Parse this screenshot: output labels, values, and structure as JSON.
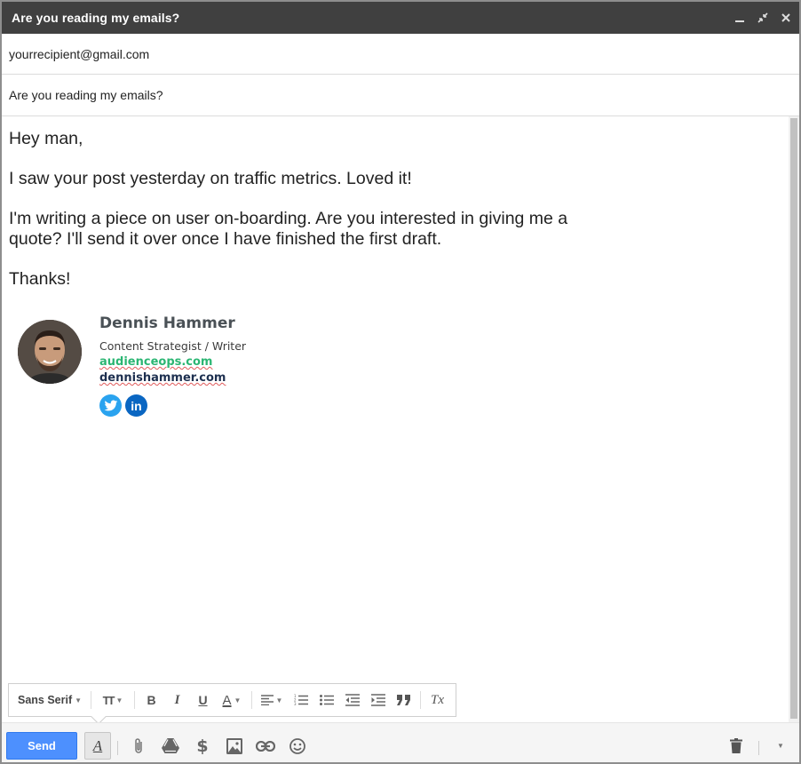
{
  "window": {
    "title": "Are you reading my emails?",
    "controls": [
      "minimize-icon",
      "pop-out-icon",
      "close-icon"
    ]
  },
  "compose": {
    "to": "yourrecipient@gmail.com",
    "subject": "Are you reading my emails?",
    "body": [
      "Hey man,",
      "I saw your post yesterday on traffic metrics. Loved it!",
      "I'm writing a piece on user on-boarding. Are you interested in giving me a quote? I'll send it over once I have finished the first draft.",
      "Thanks!"
    ]
  },
  "signature": {
    "name": "Dennis Hammer",
    "role": "Content Strategist / Writer",
    "link1": "audienceops.com",
    "link2": "dennishammer.com",
    "social": [
      "twitter-icon",
      "linkedin-icon"
    ],
    "linkedin_glyph": "in",
    "colors": {
      "link1": "#2bb673",
      "link2": "#1e3050",
      "twitter": "#2aa3ef",
      "linkedin": "#0a66c2"
    }
  },
  "format_toolbar": {
    "font": "Sans Serif",
    "icons": [
      "text-size-icon",
      "bold-icon",
      "italic-icon",
      "underline-icon",
      "text-color-icon",
      "align-icon",
      "numbered-list-icon",
      "bulleted-list-icon",
      "indent-less-icon",
      "indent-more-icon",
      "quote-icon",
      "remove-formatting-icon"
    ],
    "bold": "B",
    "italic": "I",
    "underline": "U",
    "text_color": "A",
    "remove_format": "Tx",
    "text_size": "TT"
  },
  "bottom_bar": {
    "send": "Send",
    "format_toggle": "A",
    "dollar": "$",
    "icons": [
      "formatting-options-icon",
      "attach-icon",
      "drive-icon",
      "money-icon",
      "photo-icon",
      "link-icon",
      "emoji-icon",
      "trash-icon",
      "more-options-icon"
    ],
    "accent": "#4d90fe"
  }
}
